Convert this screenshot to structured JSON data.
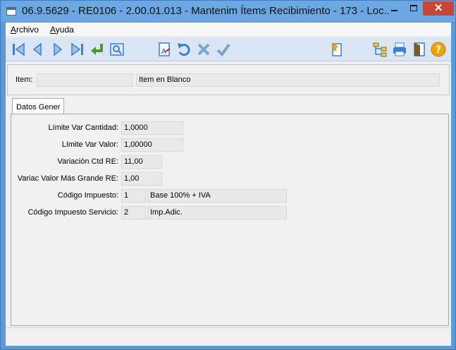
{
  "window": {
    "title": "06.9.5629 - RE0106 - 2.00.01.013 - Mantenim Ítems Recibimiento - 173 - Loc...",
    "close_label": "✕"
  },
  "menu": {
    "items": [
      {
        "label_first": "A",
        "label_rest": "rchivo"
      },
      {
        "label_first": "A",
        "label_rest": "yuda"
      }
    ]
  },
  "toolbar": {
    "buttons": [
      "first-icon",
      "previous-icon",
      "next-icon",
      "last-icon",
      "goto-icon",
      "zoom-icon",
      "new-icon",
      "undo-icon",
      "cancel-icon",
      "confirm-icon",
      "import-icon",
      "tree-icon",
      "print-icon",
      "exit-icon",
      "help-icon"
    ],
    "colors": {
      "accent": "#3b7fd1",
      "green": "#4a9a2f",
      "help": "#f2a300"
    }
  },
  "header": {
    "item_label": "Item:",
    "item_code": "",
    "item_description": "Item en Blanco"
  },
  "tabs": [
    {
      "label": "Datos Gener"
    }
  ],
  "fields": [
    {
      "label": "Límite Var Cantidad:",
      "value": "1,0000"
    },
    {
      "label": "Límite Var Valor:",
      "value": "1,00000"
    },
    {
      "label": "Variación Ctd RE:",
      "value": "11,00"
    },
    {
      "label": "Variac Valor Más Grande RE:",
      "value": "1,00"
    },
    {
      "label": "Código Impuesto:",
      "value": "1",
      "description": "Base 100% + IVA"
    },
    {
      "label": "Código Impuesto Servicio:",
      "value": "2",
      "description": "Imp.Adic."
    }
  ]
}
